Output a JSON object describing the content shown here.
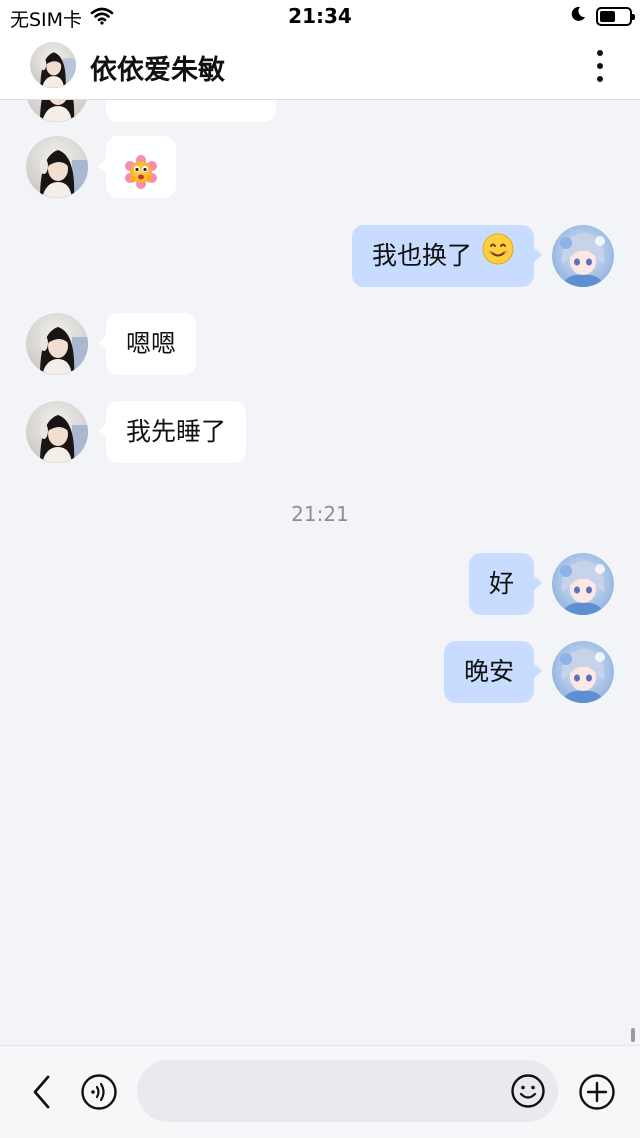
{
  "status_bar": {
    "carrier": "无SIM卡",
    "time": "21:34",
    "battery_level": 0.55
  },
  "header": {
    "title": "依依爱朱敏"
  },
  "messages": [
    {
      "side": "left",
      "text": ""
    },
    {
      "side": "left",
      "type": "sticker",
      "sticker": "pink-flower-emoji"
    },
    {
      "side": "right",
      "text": "我也换了",
      "emoji": "smiling-face"
    },
    {
      "side": "left",
      "text": "嗯嗯"
    },
    {
      "side": "left",
      "text": "我先睡了"
    },
    {
      "type": "timestamp",
      "text": "21:21"
    },
    {
      "side": "right",
      "text": "好"
    },
    {
      "side": "right",
      "text": "晚安"
    }
  ],
  "composer": {
    "value": "",
    "placeholder": ""
  },
  "icons": {
    "back": "chevron-left-icon",
    "voice": "voice-icon",
    "emoji": "emoji-icon",
    "add": "plus-icon",
    "more": "more-vertical-icon"
  },
  "colors": {
    "background": "#f3f4f8",
    "bubble_mine": "#c7dcff",
    "bubble_theirs": "#ffffff"
  }
}
